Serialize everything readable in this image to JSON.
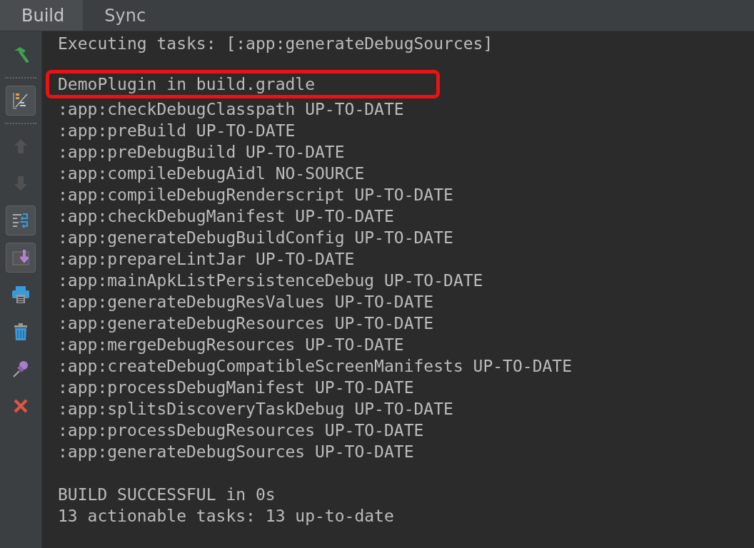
{
  "tabs": [
    {
      "label": "Build",
      "selected": true
    },
    {
      "label": "Sync",
      "selected": false
    }
  ],
  "toolbar": [
    {
      "kind": "hammer",
      "pressed": false,
      "disabled": false
    },
    {
      "kind": "separator"
    },
    {
      "kind": "soft-wrap",
      "pressed": true,
      "disabled": false
    },
    {
      "kind": "separator"
    },
    {
      "kind": "up",
      "pressed": false,
      "disabled": true
    },
    {
      "kind": "down",
      "pressed": false,
      "disabled": true
    },
    {
      "kind": "wrap-lines",
      "pressed": true,
      "disabled": false
    },
    {
      "kind": "scroll-end",
      "pressed": true,
      "disabled": false
    },
    {
      "kind": "print",
      "pressed": false,
      "disabled": false
    },
    {
      "kind": "trash",
      "pressed": false,
      "disabled": false
    },
    {
      "kind": "pin",
      "pressed": false,
      "disabled": false
    },
    {
      "kind": "close",
      "pressed": false,
      "disabled": false
    }
  ],
  "console": [
    {
      "lines": [
        {
          "text": "Executing tasks: [:app:generateDebugSources]",
          "highlighted": false
        }
      ]
    },
    {
      "lines": [
        {
          "text": "DemoPlugin in build.gradle",
          "highlighted": true
        },
        {
          "text": ":app:checkDebugClasspath UP-TO-DATE",
          "highlighted": false
        },
        {
          "text": ":app:preBuild UP-TO-DATE",
          "highlighted": false
        },
        {
          "text": ":app:preDebugBuild UP-TO-DATE",
          "highlighted": false
        },
        {
          "text": ":app:compileDebugAidl NO-SOURCE",
          "highlighted": false
        },
        {
          "text": ":app:compileDebugRenderscript UP-TO-DATE",
          "highlighted": false
        },
        {
          "text": ":app:checkDebugManifest UP-TO-DATE",
          "highlighted": false
        },
        {
          "text": ":app:generateDebugBuildConfig UP-TO-DATE",
          "highlighted": false
        },
        {
          "text": ":app:prepareLintJar UP-TO-DATE",
          "highlighted": false
        },
        {
          "text": ":app:mainApkListPersistenceDebug UP-TO-DATE",
          "highlighted": false
        },
        {
          "text": ":app:generateDebugResValues UP-TO-DATE",
          "highlighted": false
        },
        {
          "text": ":app:generateDebugResources UP-TO-DATE",
          "highlighted": false
        },
        {
          "text": ":app:mergeDebugResources UP-TO-DATE",
          "highlighted": false
        },
        {
          "text": ":app:createDebugCompatibleScreenManifests UP-TO-DATE",
          "highlighted": false
        },
        {
          "text": ":app:processDebugManifest UP-TO-DATE",
          "highlighted": false
        },
        {
          "text": ":app:splitsDiscoveryTaskDebug UP-TO-DATE",
          "highlighted": false
        },
        {
          "text": ":app:processDebugResources UP-TO-DATE",
          "highlighted": false
        },
        {
          "text": ":app:generateDebugSources UP-TO-DATE",
          "highlighted": false
        }
      ]
    },
    {
      "lines": [
        {
          "text": "BUILD SUCCESSFUL in 0s",
          "highlighted": false
        },
        {
          "text": "13 actionable tasks: 13 up-to-date",
          "highlighted": false
        }
      ]
    }
  ]
}
